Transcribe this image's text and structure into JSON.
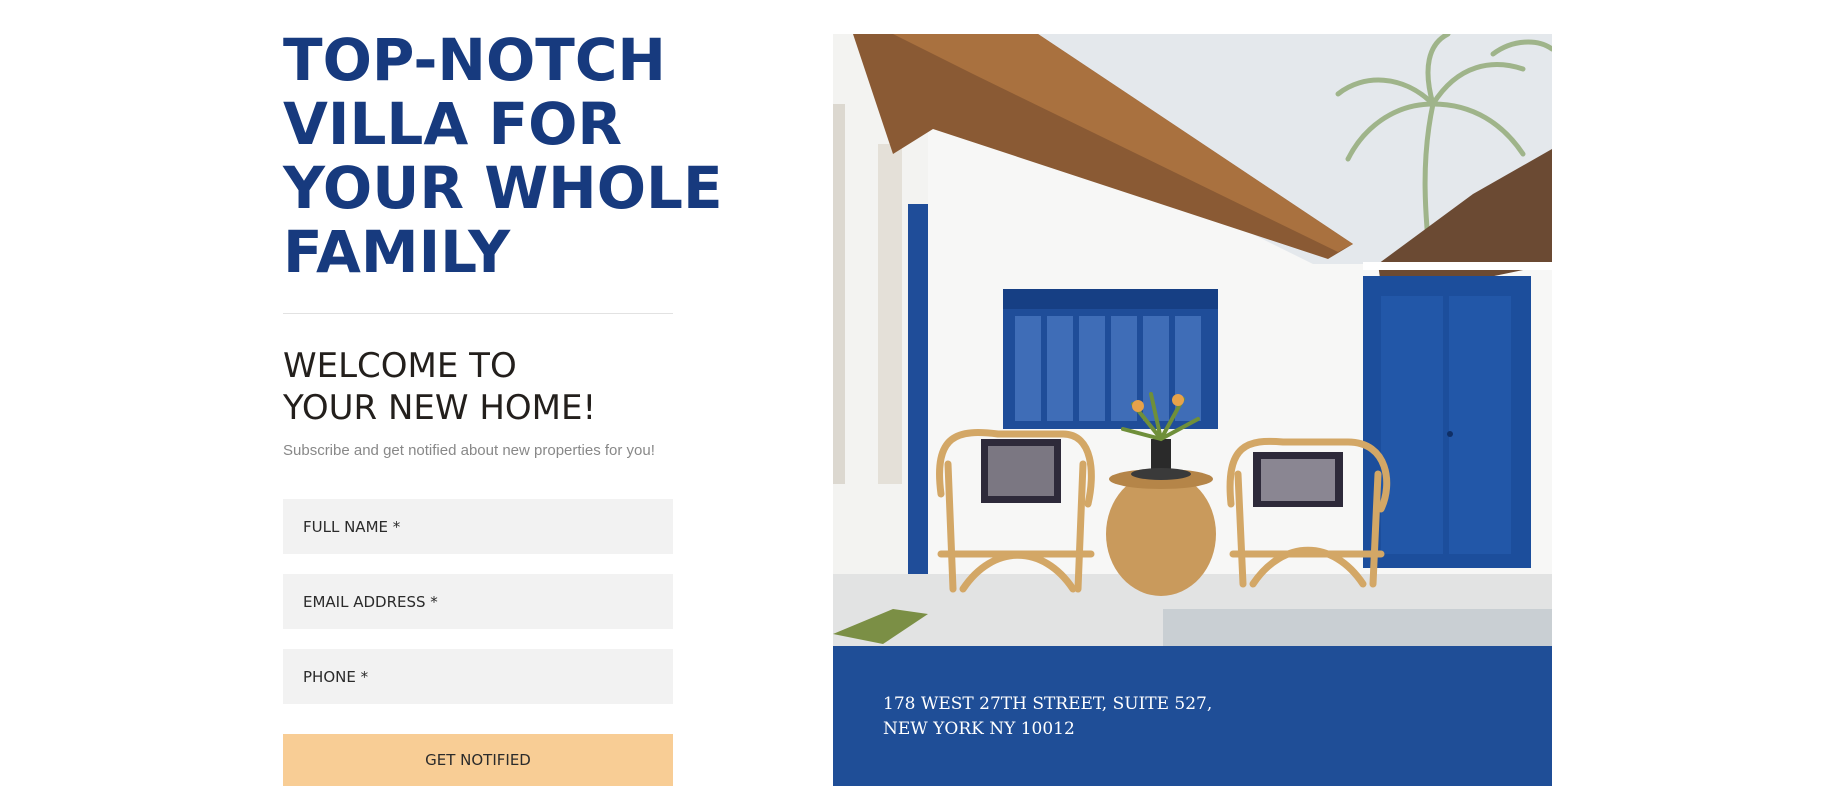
{
  "hero": {
    "title_lines": [
      "TOP-NOTCH",
      "VILLA FOR",
      "YOUR WHOLE",
      "FAMILY"
    ]
  },
  "signup": {
    "heading_lines": [
      "WELCOME TO",
      "YOUR NEW HOME!"
    ],
    "subtitle": "Subscribe and get notified about new properties for you!",
    "fields": {
      "full_name": {
        "placeholder": "FULL NAME *",
        "value": ""
      },
      "email": {
        "placeholder": "EMAIL ADDRESS *",
        "value": ""
      },
      "phone": {
        "placeholder": "PHONE *",
        "value": ""
      }
    },
    "submit_label": "GET NOTIFIED"
  },
  "property": {
    "address_lines": [
      "178 WEST 27TH STREET, SUITE 527,",
      "NEW YORK NY 10012"
    ]
  },
  "colors": {
    "title_blue": "#173a7e",
    "heading_dark": "#231f1c",
    "field_bg": "#f2f2f2",
    "button_bg": "#f8cd95",
    "address_overlay": "#1b4a92"
  }
}
